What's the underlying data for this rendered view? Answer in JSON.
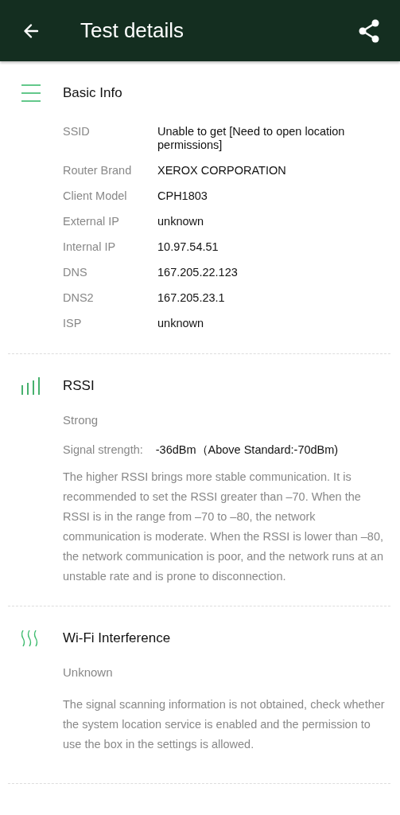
{
  "app_bar": {
    "title": "Test details"
  },
  "sections": [
    {
      "kind": "list",
      "title": "Basic Info",
      "rows": [
        {
          "label": "SSID",
          "value": "Unable to get [Need to open location permissions]"
        },
        {
          "label": "Router Brand",
          "value": "XEROX CORPORATION"
        },
        {
          "label": "Client Model",
          "value": "CPH1803"
        },
        {
          "label": "External IP",
          "value": "unknown"
        },
        {
          "label": "Internal IP",
          "value": "10.97.54.51"
        },
        {
          "label": "DNS",
          "value": "167.205.22.123"
        },
        {
          "label": "DNS2",
          "value": "167.205.23.1"
        },
        {
          "label": "ISP",
          "value": "unknown"
        }
      ]
    },
    {
      "kind": "bars",
      "title": "RSSI",
      "status": "Strong",
      "reading_label": "Signal strength:",
      "reading": "-36dBm（Above Standard:-70dBm)",
      "description": "The higher RSSI brings more stable communication. It is recommended to set the RSSI greater than –70. When the RSSI is in the range from –70 to –80, the network communication is moderate. When the RSSI is lower than –80, the network communication is poor, and the network runs at an unstable rate and is prone to disconnection."
    },
    {
      "kind": "waves",
      "title": "Wi-Fi Interference",
      "status": "Unknown",
      "description": "The signal scanning information is not obtained, check whether the system location service is enabled and the permission to use the box in the settings is allowed."
    }
  ]
}
